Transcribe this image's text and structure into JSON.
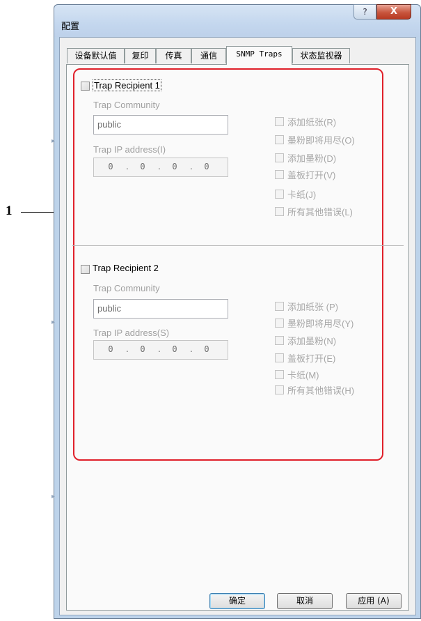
{
  "callout": {
    "number": "1"
  },
  "window": {
    "title": "配置",
    "help_symbol": "?",
    "close_symbol": "X",
    "tabs": [
      "设备默认值",
      "复印",
      "传真",
      "通信",
      "SNMP Traps",
      "状态监视器"
    ],
    "active_tab": 4,
    "highlight_color": "#e0202a"
  },
  "recipient1": {
    "label": "Trap Recipient 1",
    "community_label": "Trap Community",
    "community_value": "public",
    "ip_label": "Trap IP address(I)",
    "ip_octets": [
      "0",
      "0",
      "0",
      "0"
    ],
    "options": [
      "添加纸张(R)",
      "墨粉即将用尽(O)",
      "添加墨粉(D)",
      "盖板打开(V)",
      "卡纸(J)",
      "所有其他错误(L)"
    ]
  },
  "recipient2": {
    "label": "Trap Recipient 2",
    "community_label": "Trap Community",
    "community_value": "public",
    "ip_label": "Trap IP address(S)",
    "ip_octets": [
      "0",
      "0",
      "0",
      "0"
    ],
    "options": [
      "添加纸张 (P)",
      "墨粉即将用尽(Y)",
      "添加墨粉(N)",
      "盖板打开(E)",
      "卡纸(M)",
      "所有其他错误(H)"
    ]
  },
  "buttons": {
    "ok": "确定",
    "cancel": "取消",
    "apply": "应用 (A)"
  }
}
